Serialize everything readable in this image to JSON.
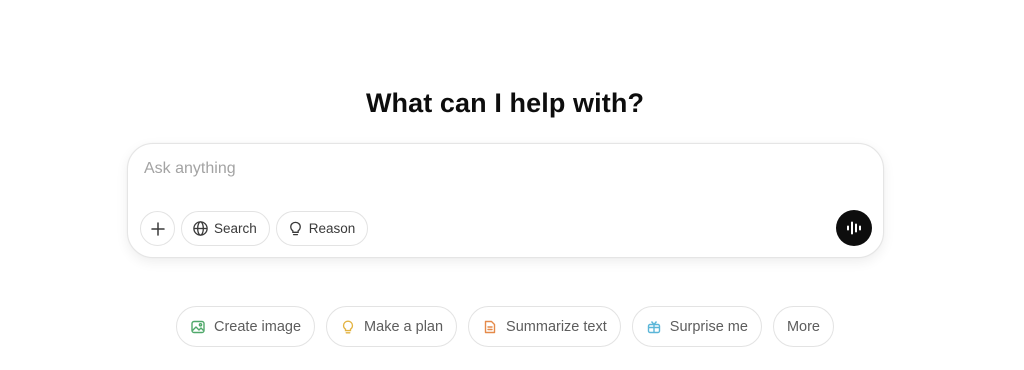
{
  "heading": "What can I help with?",
  "composer": {
    "placeholder": "Ask anything",
    "value": "",
    "tools": {
      "search_label": "Search",
      "reason_label": "Reason"
    }
  },
  "suggestions": [
    {
      "label": "Create image",
      "icon": "image-icon",
      "color": "#4fa86a"
    },
    {
      "label": "Make a plan",
      "icon": "lightbulb-icon",
      "color": "#e3b341"
    },
    {
      "label": "Summarize text",
      "icon": "document-icon",
      "color": "#e58a4a"
    },
    {
      "label": "Surprise me",
      "icon": "gift-icon",
      "color": "#5bb6d8"
    },
    {
      "label": "More",
      "icon": "",
      "color": "#5d5d5d"
    }
  ]
}
